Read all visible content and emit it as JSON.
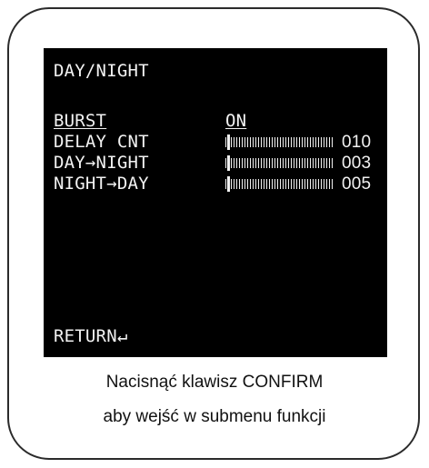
{
  "screen": {
    "title": "DAY/NIGHT",
    "items": [
      {
        "label": "BURST",
        "value": "ON"
      },
      {
        "label": "DELAY CNT",
        "value": "010",
        "level": 0.02
      },
      {
        "label": "DAY→NIGHT",
        "value": "003",
        "level": 0.02
      },
      {
        "label": "NIGHT→DAY",
        "value": "005",
        "level": 0.02
      }
    ],
    "return_label": "RETURN↵"
  },
  "caption": {
    "line1": "Nacisnąć klawisz CONFIRM",
    "line2": "aby wejść w submenu funkcji"
  }
}
